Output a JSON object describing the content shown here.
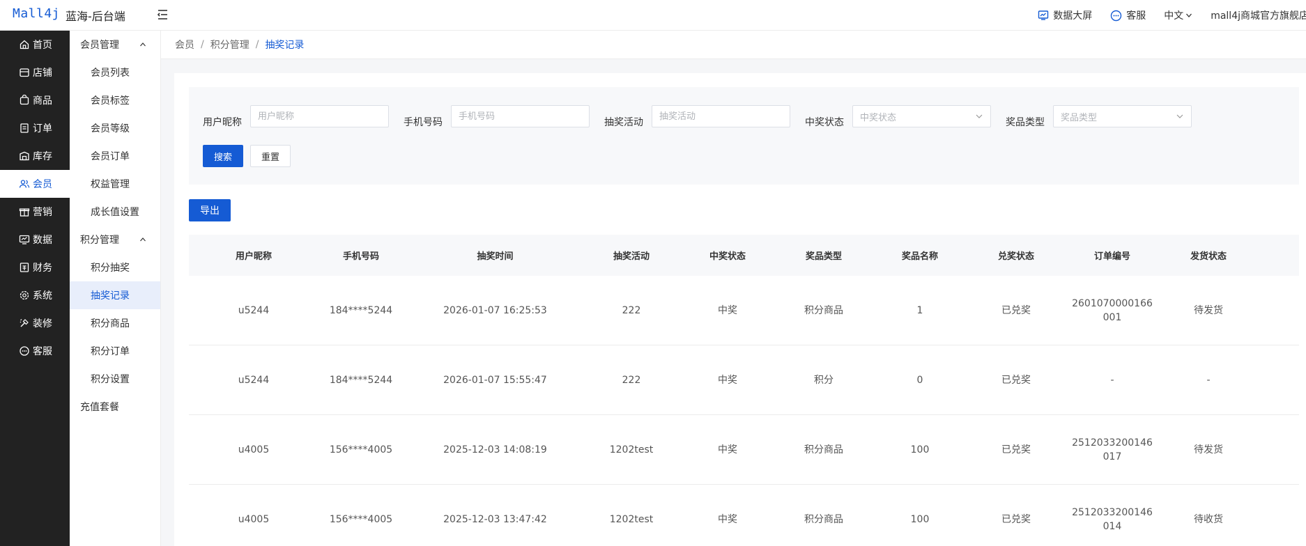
{
  "header": {
    "logo": "Mall4j",
    "site_name": "蓝海-后台端",
    "data_screen": "数据大屏",
    "customer_service": "客服",
    "language": "中文",
    "shop_name": "mall4j商城官方旗舰店"
  },
  "sidebar": {
    "items": [
      {
        "label": "首页",
        "icon": "home-icon"
      },
      {
        "label": "店铺",
        "icon": "store-icon"
      },
      {
        "label": "商品",
        "icon": "product-icon"
      },
      {
        "label": "订单",
        "icon": "order-icon"
      },
      {
        "label": "库存",
        "icon": "inventory-icon"
      },
      {
        "label": "会员",
        "icon": "member-icon"
      },
      {
        "label": "营销",
        "icon": "gift-icon"
      },
      {
        "label": "数据",
        "icon": "chart-icon"
      },
      {
        "label": "财务",
        "icon": "finance-icon"
      },
      {
        "label": "系统",
        "icon": "settings-icon"
      },
      {
        "label": "装修",
        "icon": "decoration-icon"
      },
      {
        "label": "客服",
        "icon": "chat-icon"
      }
    ],
    "active_index": 5
  },
  "submenu": {
    "group1": "会员管理",
    "group1_items": [
      "会员列表",
      "会员标签",
      "会员等级",
      "会员订单",
      "权益管理",
      "成长值设置"
    ],
    "group2": "积分管理",
    "group2_items": [
      "积分抽奖",
      "抽奖记录",
      "积分商品",
      "积分订单",
      "积分设置"
    ],
    "extra": "充值套餐",
    "active": "抽奖记录"
  },
  "breadcrumb": [
    "会员",
    "积分管理",
    "抽奖记录"
  ],
  "search": {
    "nickname_label": "用户昵称",
    "nickname_placeholder": "用户昵称",
    "phone_label": "手机号码",
    "phone_placeholder": "手机号码",
    "activity_label": "抽奖活动",
    "activity_placeholder": "抽奖活动",
    "win_status_label": "中奖状态",
    "win_status_placeholder": "中奖状态",
    "prize_type_label": "奖品类型",
    "prize_type_placeholder": "奖品类型",
    "search_button": "搜索",
    "reset_button": "重置"
  },
  "export_button": "导出",
  "table": {
    "headers": [
      "用户昵称",
      "手机号码",
      "抽奖时间",
      "抽奖活动",
      "中奖状态",
      "奖品类型",
      "奖品名称",
      "兑奖状态",
      "订单编号",
      "发货状态"
    ],
    "rows": [
      [
        "u5244",
        "184****5244",
        "2026-01-07 16:25:53",
        "222",
        "中奖",
        "积分商品",
        "1",
        "已兑奖",
        "2601070000166001",
        "待发货"
      ],
      [
        "u5244",
        "184****5244",
        "2026-01-07 15:55:47",
        "222",
        "中奖",
        "积分",
        "0",
        "已兑奖",
        "-",
        "-"
      ],
      [
        "u4005",
        "156****4005",
        "2025-12-03 14:08:19",
        "1202test",
        "中奖",
        "积分商品",
        "100",
        "已兑奖",
        "2512033200146017",
        "待发货"
      ],
      [
        "u4005",
        "156****4005",
        "2025-12-03 13:47:42",
        "1202test",
        "中奖",
        "积分商品",
        "100",
        "已兑奖",
        "2512033200146014",
        "待收货"
      ]
    ]
  },
  "colors": {
    "primary": "#155bd4",
    "sidebar_bg": "#222222",
    "active_submenu_bg": "#e8eefb"
  }
}
